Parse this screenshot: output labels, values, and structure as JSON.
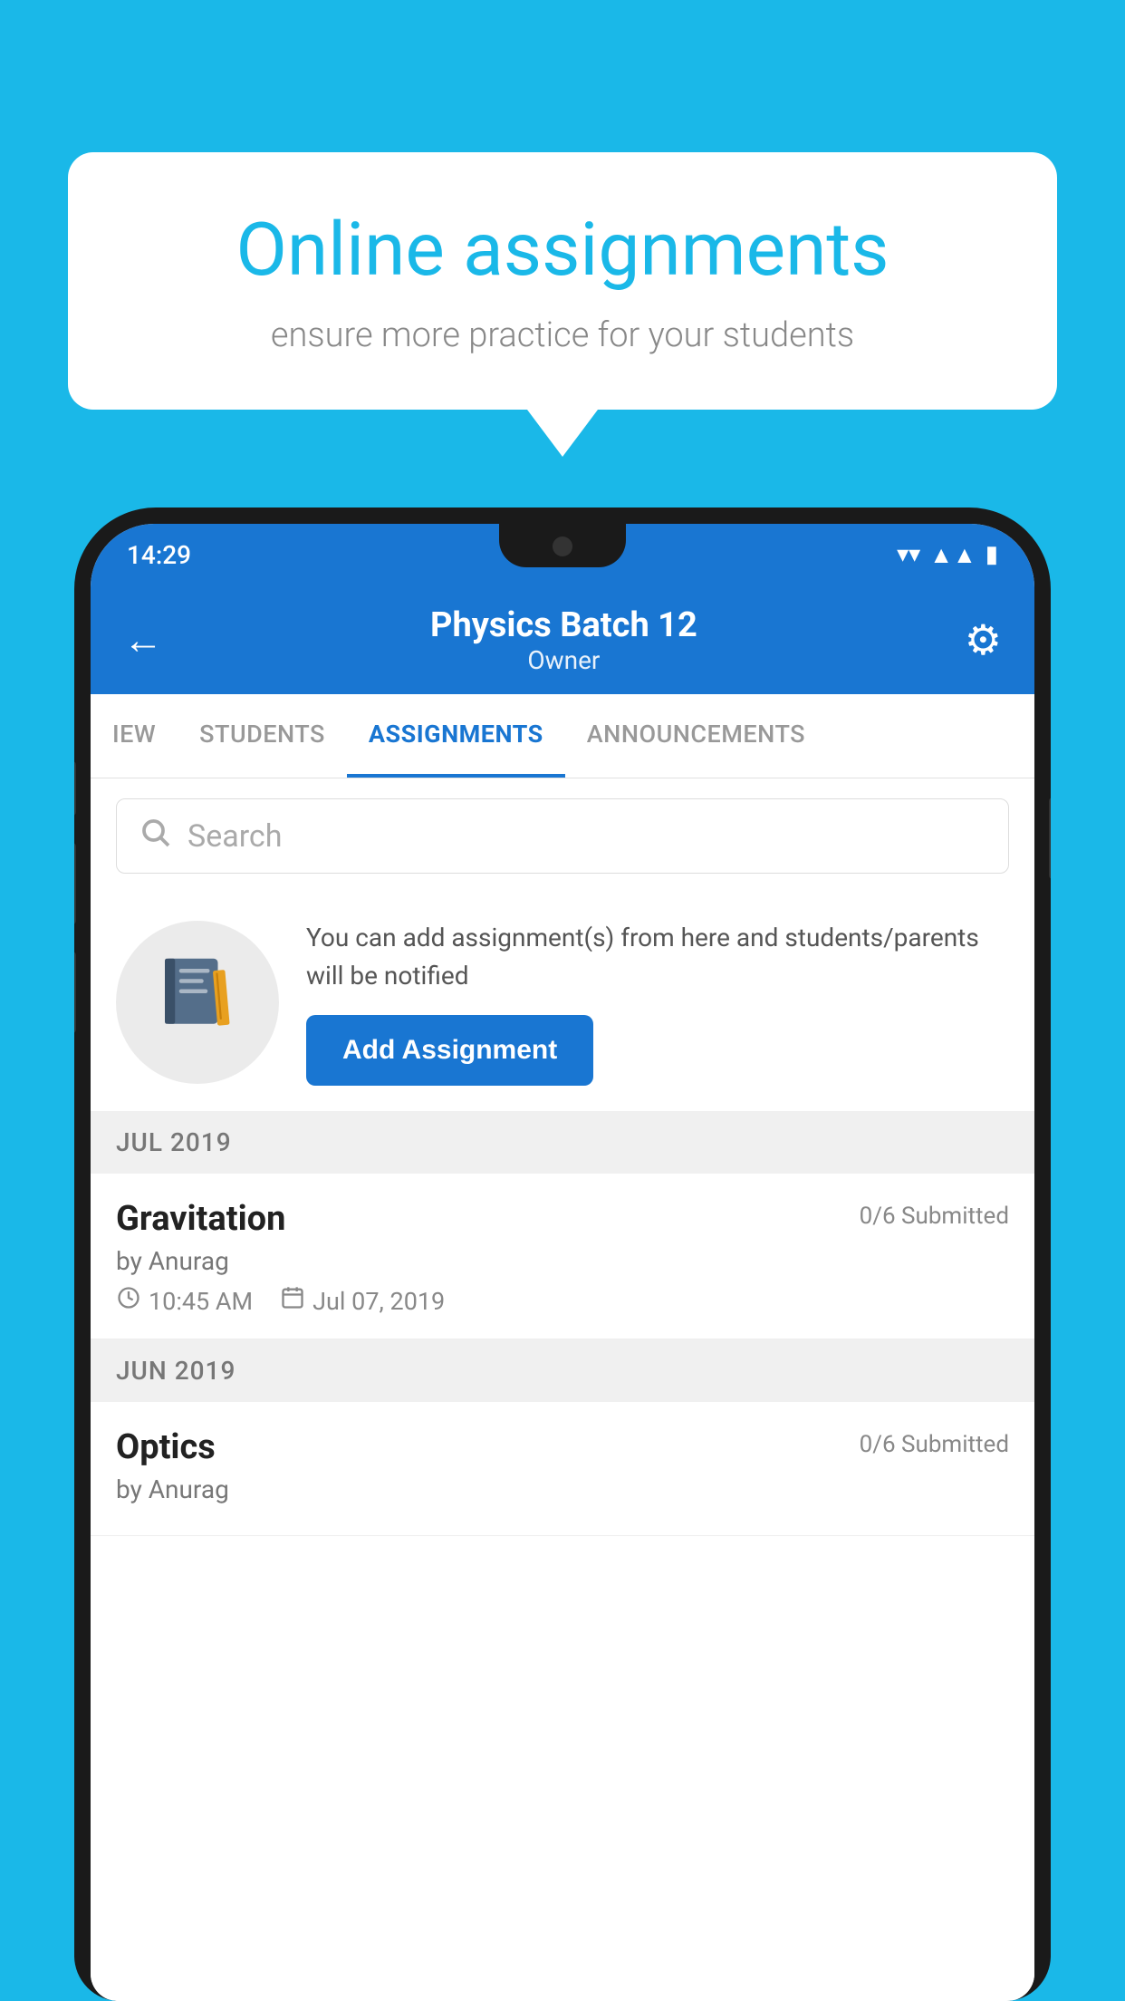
{
  "background_color": "#1ab8e8",
  "speech_bubble": {
    "title": "Online assignments",
    "subtitle": "ensure more practice for your students"
  },
  "phone": {
    "status_bar": {
      "time": "14:29",
      "icons": [
        "wifi",
        "signal",
        "battery"
      ]
    },
    "header": {
      "title": "Physics Batch 12",
      "subtitle": "Owner",
      "back_label": "←",
      "settings_label": "⚙"
    },
    "tabs": [
      {
        "label": "IEW",
        "active": false
      },
      {
        "label": "STUDENTS",
        "active": false
      },
      {
        "label": "ASSIGNMENTS",
        "active": true
      },
      {
        "label": "ANNOUNCEMENTS",
        "active": false
      }
    ],
    "search": {
      "placeholder": "Search"
    },
    "promo": {
      "text": "You can add assignment(s) from here and students/parents will be notified",
      "button_label": "Add Assignment"
    },
    "sections": [
      {
        "header": "JUL 2019",
        "assignments": [
          {
            "title": "Gravitation",
            "submitted": "0/6 Submitted",
            "author": "by Anurag",
            "time": "10:45 AM",
            "date": "Jul 07, 2019"
          }
        ]
      },
      {
        "header": "JUN 2019",
        "assignments": [
          {
            "title": "Optics",
            "submitted": "0/6 Submitted",
            "author": "by Anurag",
            "time": "",
            "date": ""
          }
        ]
      }
    ]
  }
}
